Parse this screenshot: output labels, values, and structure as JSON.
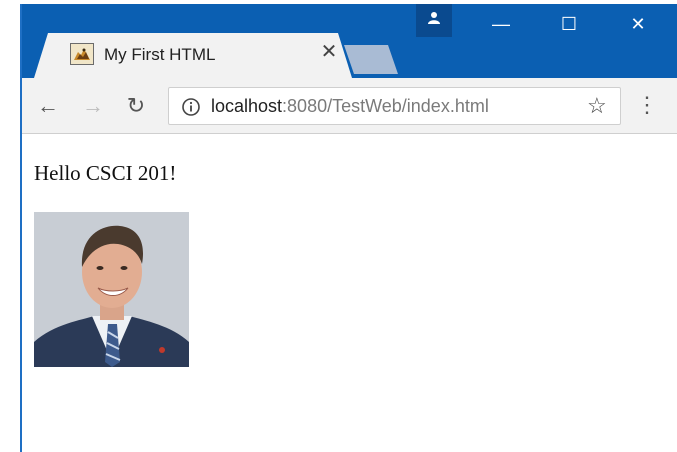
{
  "browser": {
    "tab_title": "My First HTML",
    "tab_favicon": "cat-favicon-icon",
    "url_host": "localhost",
    "url_rest": ":8080/TestWeb/index.html",
    "icons": {
      "close": "close-icon",
      "back": "back-arrow-icon",
      "forward": "forward-arrow-icon",
      "reload": "reload-icon",
      "info": "info-icon",
      "bookmark": "star-icon",
      "menu": "kebab-menu-icon",
      "profile": "profile-icon"
    },
    "colors": {
      "titlebar": "#0b5fb2",
      "toolbar": "#f2f2f2"
    }
  },
  "page": {
    "greeting": "Hello CSCI 201!",
    "photo": "portrait-photo"
  }
}
